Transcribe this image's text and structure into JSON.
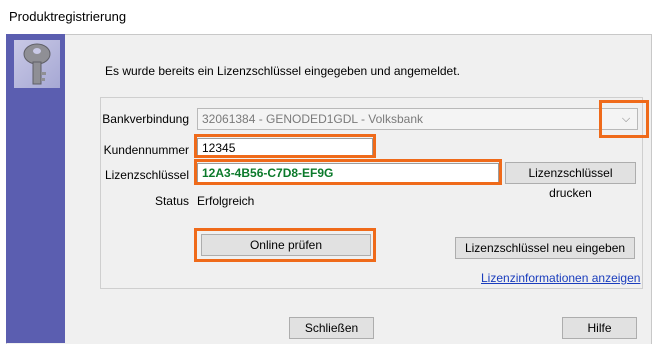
{
  "window": {
    "title": "Produktregistrierung"
  },
  "intro_text": "Es wurde bereits ein Lizenzschlüssel eingegeben und angemeldet.",
  "icon": "key-icon",
  "fields": {
    "bank": {
      "label": "Bankverbindung",
      "value": "32061384 - GENODED1GDL - Volksbank"
    },
    "customer": {
      "label": "Kundennummer",
      "value": "12345"
    },
    "license": {
      "label": "Lizenzschlüssel",
      "value": "12A3-4B56-C7D8-EF9G"
    },
    "status": {
      "label": "Status",
      "value": "Erfolgreich"
    }
  },
  "buttons": {
    "print": "Lizenzschlüssel drucken",
    "online_check": "Online prüfen",
    "reenter": "Lizenzschlüssel neu eingeben",
    "close": "Schließen",
    "help": "Hilfe"
  },
  "links": {
    "license_info": "Lizenzinformationen anzeigen"
  },
  "colors": {
    "highlight": "#ef6a1a",
    "sidebar": "#5b5eb0",
    "license_text": "#0b7a2b",
    "link": "#1a3dbd"
  }
}
